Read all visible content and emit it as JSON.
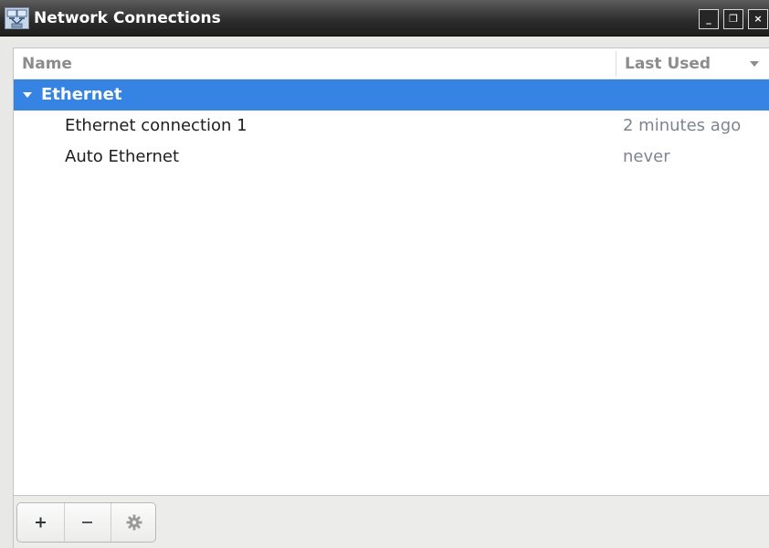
{
  "window": {
    "title": "Network Connections",
    "controls": {
      "minimize_label": "_",
      "restore_label": "❐",
      "close_label": "×"
    }
  },
  "table": {
    "columns": {
      "name": "Name",
      "last_used": "Last Used"
    },
    "sort": {
      "column": "last_used",
      "direction": "descending"
    },
    "groups": [
      {
        "label": "Ethernet",
        "expanded": true,
        "selected": true,
        "connections": [
          {
            "name": "Ethernet connection 1",
            "last_used": "2 minutes ago"
          },
          {
            "name": "Auto Ethernet",
            "last_used": "never"
          }
        ]
      }
    ]
  },
  "toolbar": {
    "buttons": [
      {
        "icon": "plus-icon",
        "action": "add"
      },
      {
        "icon": "minus-icon",
        "action": "remove"
      },
      {
        "icon": "gear-icon",
        "action": "settings"
      }
    ]
  },
  "colors": {
    "selection": "#3584e4",
    "titlebar": "#2b2b2b",
    "secondary_text": "#7d8590"
  }
}
